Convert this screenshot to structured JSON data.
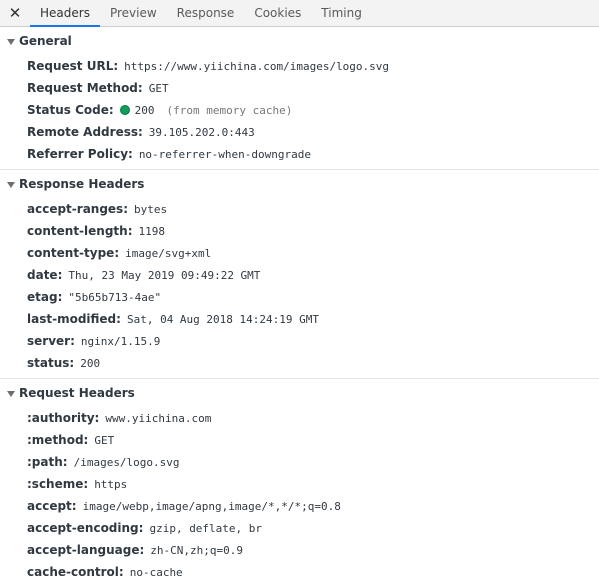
{
  "tabs": [
    {
      "label": "Headers",
      "active": true
    },
    {
      "label": "Preview",
      "active": false
    },
    {
      "label": "Response",
      "active": false
    },
    {
      "label": "Cookies",
      "active": false
    },
    {
      "label": "Timing",
      "active": false
    }
  ],
  "close_symbol": "✕",
  "general": {
    "title": "General",
    "request_url": {
      "key": "Request URL:",
      "value": "https://www.yiichina.com/images/logo.svg"
    },
    "request_method": {
      "key": "Request Method:",
      "value": "GET"
    },
    "status_code": {
      "key": "Status Code:",
      "value": "200",
      "note": "(from memory cache)",
      "status_color": "#0f9d58"
    },
    "remote_address": {
      "key": "Remote Address:",
      "value": "39.105.202.0:443"
    },
    "referrer_policy": {
      "key": "Referrer Policy:",
      "value": "no-referrer-when-downgrade"
    }
  },
  "response_headers": {
    "title": "Response Headers",
    "rows": [
      {
        "key": "accept-ranges:",
        "value": "bytes"
      },
      {
        "key": "content-length:",
        "value": "1198"
      },
      {
        "key": "content-type:",
        "value": "image/svg+xml"
      },
      {
        "key": "date:",
        "value": "Thu, 23 May 2019 09:49:22 GMT"
      },
      {
        "key": "etag:",
        "value": "\"5b65b713-4ae\""
      },
      {
        "key": "last-modified:",
        "value": "Sat, 04 Aug 2018 14:24:19 GMT"
      },
      {
        "key": "server:",
        "value": "nginx/1.15.9"
      },
      {
        "key": "status:",
        "value": "200"
      }
    ]
  },
  "request_headers": {
    "title": "Request Headers",
    "rows": [
      {
        "key": ":authority:",
        "value": "www.yiichina.com"
      },
      {
        "key": ":method:",
        "value": "GET"
      },
      {
        "key": ":path:",
        "value": "/images/logo.svg"
      },
      {
        "key": ":scheme:",
        "value": "https"
      },
      {
        "key": "accept:",
        "value": "image/webp,image/apng,image/*,*/*;q=0.8"
      },
      {
        "key": "accept-encoding:",
        "value": "gzip, deflate, br"
      },
      {
        "key": "accept-language:",
        "value": "zh-CN,zh;q=0.9"
      },
      {
        "key": "cache-control:",
        "value": "no-cache"
      }
    ]
  },
  "colors": {
    "active_tab_underline": "#1a73e8",
    "status_ok": "#0f9d58"
  }
}
